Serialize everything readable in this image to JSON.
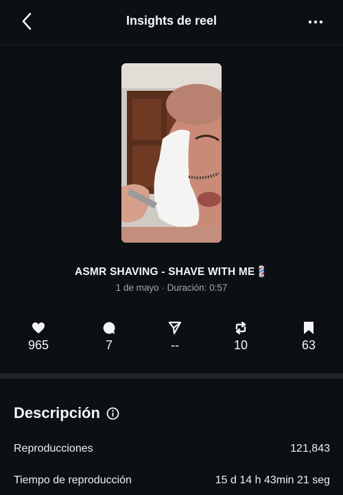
{
  "header": {
    "title": "Insights de reel",
    "back_icon": "chevron-left-icon",
    "more_icon": "more-horizontal-icon"
  },
  "reel": {
    "title": "ASMR SHAVING - SHAVE WITH ME💈",
    "meta": "1 de mayo · Duración: 0:57"
  },
  "stats": [
    {
      "icon": "heart-icon",
      "value": "965"
    },
    {
      "icon": "comment-icon",
      "value": "7"
    },
    {
      "icon": "share-icon",
      "value": "--"
    },
    {
      "icon": "repost-icon",
      "value": "10"
    },
    {
      "icon": "bookmark-icon",
      "value": "63"
    }
  ],
  "description": {
    "title": "Descripción",
    "rows": [
      {
        "label": "Reproducciones",
        "value": "121,843"
      },
      {
        "label": "Tiempo de reproducción",
        "value": "15 d 14 h 43min 21 seg"
      }
    ]
  },
  "colors": {
    "background": "#0c1014",
    "divider": "#1f2428",
    "text": "#f5f5f5",
    "muted": "#a8a8a8"
  }
}
